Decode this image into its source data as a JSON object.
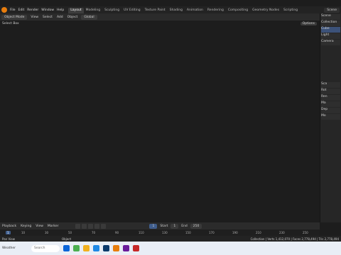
{
  "topbar": {
    "menu": [
      "File",
      "Edit",
      "Render",
      "Window",
      "Help"
    ],
    "workspaces": [
      "Layout",
      "Modeling",
      "Sculpting",
      "UV Editing",
      "Texture Paint",
      "Shading",
      "Animation",
      "Rendering",
      "Compositing",
      "Geometry Nodes",
      "Scripting"
    ],
    "active_workspace": "Layout",
    "scene": "Scene"
  },
  "viewport_header": {
    "mode": "Object Mode",
    "view": "View",
    "select": "Select",
    "add": "Add",
    "object": "Object",
    "orientation": "Global",
    "select_box": "Select Box",
    "options": "Options"
  },
  "timeline": {
    "playback": "Playback",
    "keying": "Keying",
    "view": "View",
    "marker": "Marker",
    "current_frame": "1",
    "start_label": "Start",
    "start": "1",
    "end_label": "End",
    "end": "250",
    "ruler": [
      "10",
      "30",
      "50",
      "70",
      "90",
      "110",
      "130",
      "150",
      "170",
      "190",
      "210",
      "230",
      "250"
    ],
    "ruler_cur": "1"
  },
  "statusbar": {
    "left": "Pan View",
    "mid": "Object",
    "right": "Collection | Verts 1,412,070 | Faces 2,778,494 | Tris 2,778,494"
  },
  "outliner": {
    "items": [
      "Scene",
      "Collection",
      "Cube",
      "Light",
      "Camera"
    ]
  },
  "properties": {
    "labels": [
      "Sca",
      "Rot",
      "Ren",
      "Ma",
      "Dep",
      "Mo"
    ]
  },
  "taskbar": {
    "weather": "Weather",
    "search": "Search"
  },
  "colors": {
    "accent": "#e87d0d",
    "mesh": "#d4550a",
    "select_blue": "#3f5d8c"
  }
}
